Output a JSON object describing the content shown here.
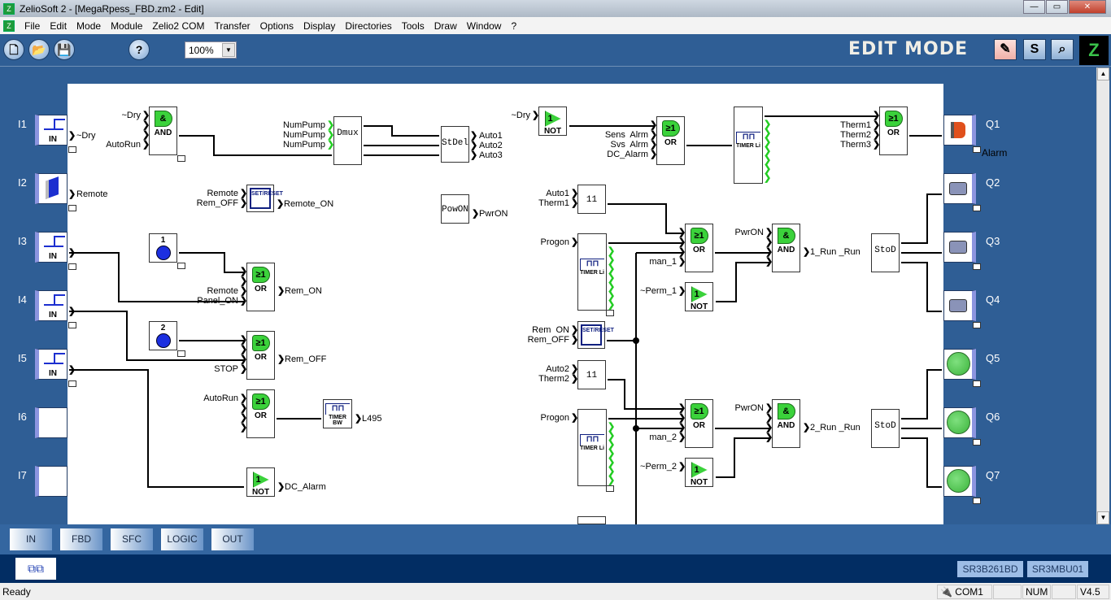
{
  "window": {
    "title": "ZelioSoft 2 - [MegaRpess_FBD.zm2 - Edit]",
    "controls": [
      "—",
      "▭",
      "✕"
    ]
  },
  "menu": [
    "File",
    "Edit",
    "Mode",
    "Module",
    "Zelio2 COM",
    "Transfer",
    "Options",
    "Display",
    "Directories",
    "Tools",
    "Draw",
    "Window",
    "?"
  ],
  "toolbar": {
    "new": "🗋",
    "open": "📂",
    "save": "💾",
    "help": "?",
    "zoom": "100%",
    "mode_label": "EDIT MODE",
    "edit_btn": "✎",
    "sim_btn": "S",
    "monitor_btn": "⌕",
    "logo": "Z"
  },
  "inputs": [
    {
      "id": "I1",
      "text": "IN",
      "symbol": "F-step",
      "out_label": "~Dry"
    },
    {
      "id": "I2",
      "text": "",
      "symbol": "switch",
      "out_label": "Remote"
    },
    {
      "id": "I3",
      "text": "IN",
      "symbol": "step",
      "out_label": ""
    },
    {
      "id": "I4",
      "text": "IN",
      "symbol": "step",
      "out_label": ""
    },
    {
      "id": "I5",
      "text": "IN",
      "symbol": "step",
      "out_label": ""
    },
    {
      "id": "I6",
      "text": "",
      "symbol": "empty",
      "out_label": ""
    },
    {
      "id": "I7",
      "text": "",
      "symbol": "empty",
      "out_label": ""
    }
  ],
  "outputs": [
    {
      "id": "Q1",
      "symbol": "alarm-bell",
      "label": "Alarm"
    },
    {
      "id": "Q2",
      "symbol": "motor",
      "label": ""
    },
    {
      "id": "Q3",
      "symbol": "motor",
      "label": ""
    },
    {
      "id": "Q4",
      "symbol": "motor",
      "label": ""
    },
    {
      "id": "Q5",
      "symbol": "green-lamp",
      "label": ""
    },
    {
      "id": "Q6",
      "symbol": "green-lamp",
      "label": ""
    },
    {
      "id": "Q7",
      "symbol": "green-lamp",
      "label": ""
    }
  ],
  "blocks": [
    {
      "type": "AND",
      "in": [
        "~Dry",
        "",
        "",
        "AutoRun"
      ],
      "out": ""
    },
    {
      "type": "Dmux",
      "in": [
        "NumPump",
        "NumPump",
        "NumPump"
      ],
      "out": ""
    },
    {
      "type": "StDel",
      "in": [],
      "out": "Auto1\nAuto2\nAuto3"
    },
    {
      "type": "SET/RESET",
      "in": [
        "Remote",
        "Rem_OFF"
      ],
      "out": "Remote_ON"
    },
    {
      "type": "PowON",
      "in": [],
      "out": "PwrON"
    },
    {
      "type": "1",
      "in": [],
      "out": ""
    },
    {
      "type": "OR",
      "in": [
        "",
        "",
        "Remote",
        "Panel_ON"
      ],
      "out": "Rem_ON"
    },
    {
      "type": "2",
      "in": [],
      "out": ""
    },
    {
      "type": "OR",
      "in": [
        "",
        "",
        "",
        "STOP"
      ],
      "out": "Rem_OFF"
    },
    {
      "type": "OR",
      "in": [
        "AutoRun",
        "",
        "",
        ""
      ],
      "out": ""
    },
    {
      "type": "TIMER BW",
      "in": [],
      "out": "L495"
    },
    {
      "type": "NOT",
      "in": [],
      "out": "DC_Alarm"
    },
    {
      "type": "NOT",
      "in": [
        "~Dry"
      ],
      "out": ""
    },
    {
      "type": "OR",
      "in": [
        "",
        "Sens  Alrm",
        "Svs  Alrm",
        "DC_Alarm"
      ],
      "out": ""
    },
    {
      "type": "TIMER Li",
      "in": [],
      "out": ""
    },
    {
      "type": "OR",
      "in": [
        "",
        "Therm1",
        "Therm2",
        "Therm3"
      ],
      "out": ""
    },
    {
      "type": "11",
      "in": [
        "Auto1",
        "Therm1"
      ],
      "out": ""
    },
    {
      "type": "TIMER Li",
      "in": [
        "Progon"
      ],
      "out": ""
    },
    {
      "type": "OR",
      "in": [
        "",
        "",
        "",
        "man_1"
      ],
      "out": ""
    },
    {
      "type": "NOT",
      "in": [
        "~Perm_1"
      ],
      "out": ""
    },
    {
      "type": "AND",
      "in": [
        "PwrON",
        "",
        "",
        ""
      ],
      "out": "1_Run _Run"
    },
    {
      "type": "StoD",
      "in": [],
      "out": ""
    },
    {
      "type": "SET/RESET",
      "in": [
        "Rem  ON",
        "Rem_OFF"
      ],
      "out": ""
    },
    {
      "type": "11",
      "in": [
        "Auto2",
        "Therm2"
      ],
      "out": ""
    },
    {
      "type": "TIMER Li",
      "in": [
        "Progon"
      ],
      "out": ""
    },
    {
      "type": "OR",
      "in": [
        "",
        "",
        "",
        "man_2"
      ],
      "out": ""
    },
    {
      "type": "NOT",
      "in": [
        "~Perm_2"
      ],
      "out": ""
    },
    {
      "type": "AND",
      "in": [
        "PwrON",
        "",
        "",
        ""
      ],
      "out": "2_Run _Run"
    },
    {
      "type": "StoD",
      "in": [],
      "out": ""
    },
    {
      "type": "",
      "in": [],
      "out": ""
    }
  ],
  "bottom_tabs": [
    "IN",
    "FBD",
    "SFC",
    "LOGIC",
    "OUT"
  ],
  "module_refs": [
    "SR3B261BD",
    "SR3MBU01"
  ],
  "status": {
    "text": "Ready",
    "com": "COM1",
    "num": "NUM",
    "version": "V4.5"
  },
  "colors": {
    "background": "#2f5e95",
    "gate_green": "#3bd23b",
    "dark_bar": "#022d63"
  }
}
